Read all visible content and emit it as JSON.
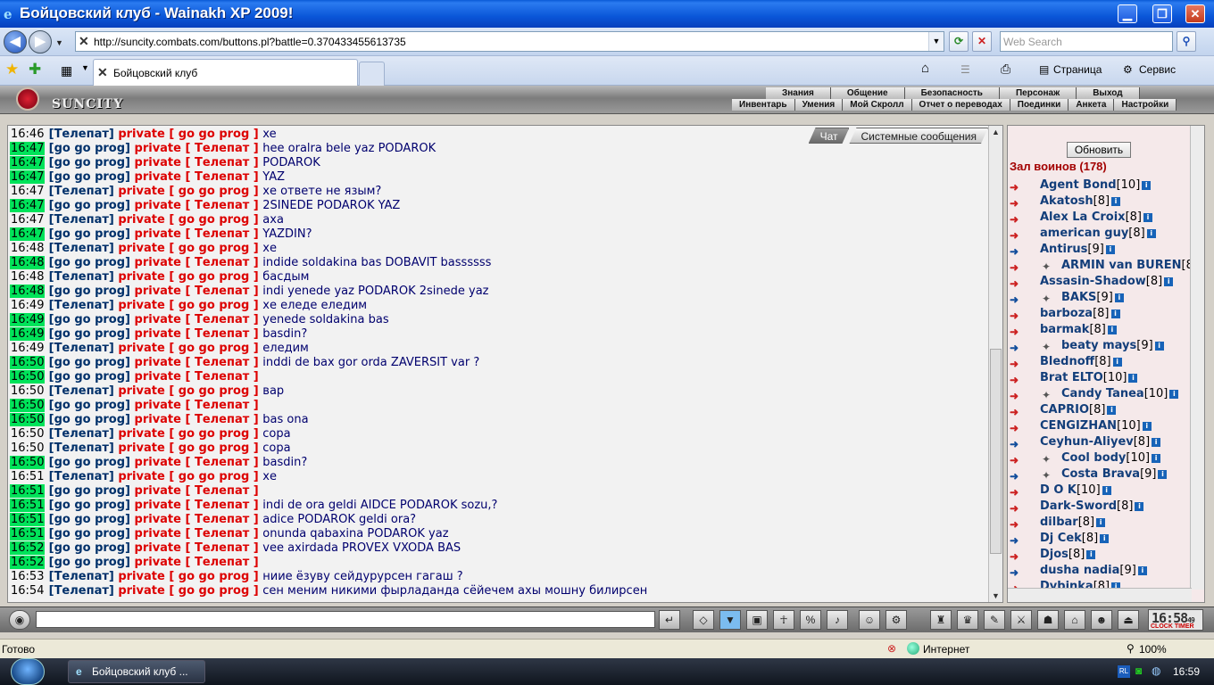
{
  "window": {
    "title": "Бойцовский клуб - Wainakh XP 2009!",
    "minimize": "▁",
    "maximize": "❐",
    "close": "✕"
  },
  "browser": {
    "url": "http://suncity.combats.com/buttons.pl?battle=0.370433455613735",
    "search_placeholder": "Web Search",
    "tab_title": "Бойцовский клуб",
    "page_menu": "Страница",
    "tools_menu": "Сервис",
    "status": "Готово",
    "zone": "Интернет",
    "zoom": "100%"
  },
  "game": {
    "logo": "SUNCITY",
    "menu_top": [
      "Знания",
      "Общение",
      "Безопасность",
      "Персонаж",
      "Выход"
    ],
    "menu_sub": [
      "Инвентарь",
      "Умения",
      "Мой Скролл",
      "Отчет о переводах",
      "Поединки",
      "Анкета",
      "Настройки"
    ],
    "chat_tabs": [
      "Чат",
      "Системные сообщения"
    ],
    "refresh_label": "Обновить",
    "hall_title": "Зал воинов (178)",
    "clock_time": "16:58",
    "clock_sec": "49",
    "clock_label": "CLOCK TIMER"
  },
  "chat": [
    {
      "time": "16:46",
      "hl": false,
      "from": "Телепат",
      "to": "go go prog",
      "msg": "xe"
    },
    {
      "time": "16:47",
      "hl": true,
      "from": "go go prog",
      "to": "Телепат",
      "msg": "hee oralra bele yaz PODAROK"
    },
    {
      "time": "16:47",
      "hl": true,
      "from": "go go prog",
      "to": "Телепат",
      "msg": "PODAROK"
    },
    {
      "time": "16:47",
      "hl": true,
      "from": "go go prog",
      "to": "Телепат",
      "msg": "YAZ"
    },
    {
      "time": "16:47",
      "hl": false,
      "from": "Телепат",
      "to": "go go prog",
      "msg": "хе ответе не язым?"
    },
    {
      "time": "16:47",
      "hl": true,
      "from": "go go prog",
      "to": "Телепат",
      "msg": "2SINEDE PODAROK YAZ"
    },
    {
      "time": "16:47",
      "hl": false,
      "from": "Телепат",
      "to": "go go prog",
      "msg": "аха"
    },
    {
      "time": "16:47",
      "hl": true,
      "from": "go go prog",
      "to": "Телепат",
      "msg": "YAZDIN?"
    },
    {
      "time": "16:48",
      "hl": false,
      "from": "Телепат",
      "to": "go go prog",
      "msg": "хе"
    },
    {
      "time": "16:48",
      "hl": true,
      "from": "go go prog",
      "to": "Телепат",
      "msg": "indide soldakina bas DOBAVIT bassssss"
    },
    {
      "time": "16:48",
      "hl": false,
      "from": "Телепат",
      "to": "go go prog",
      "msg": "басдым"
    },
    {
      "time": "16:48",
      "hl": true,
      "from": "go go prog",
      "to": "Телепат",
      "msg": "indi yenede yaz PODAROK 2sinede yaz"
    },
    {
      "time": "16:49",
      "hl": false,
      "from": "Телепат",
      "to": "go go prog",
      "msg": "хе еледе еледим"
    },
    {
      "time": "16:49",
      "hl": true,
      "from": "go go prog",
      "to": "Телепат",
      "msg": "yenede soldakina bas"
    },
    {
      "time": "16:49",
      "hl": true,
      "from": "go go prog",
      "to": "Телепат",
      "msg": "basdin?"
    },
    {
      "time": "16:49",
      "hl": false,
      "from": "Телепат",
      "to": "go go prog",
      "msg": "еледим"
    },
    {
      "time": "16:50",
      "hl": true,
      "from": "go go prog",
      "to": "Телепат",
      "msg": "inddi de bax gor orda ZAVERSIT var ?"
    },
    {
      "time": "16:50",
      "hl": true,
      "from": "go go prog",
      "to": "Телепат",
      "msg": ""
    },
    {
      "time": "16:50",
      "hl": false,
      "from": "Телепат",
      "to": "go go prog",
      "msg": "вар"
    },
    {
      "time": "16:50",
      "hl": true,
      "from": "go go prog",
      "to": "Телепат",
      "msg": ""
    },
    {
      "time": "16:50",
      "hl": true,
      "from": "go go prog",
      "to": "Телепат",
      "msg": "bas ona"
    },
    {
      "time": "16:50",
      "hl": false,
      "from": "Телепат",
      "to": "go go prog",
      "msg": "сора"
    },
    {
      "time": "16:50",
      "hl": false,
      "from": "Телепат",
      "to": "go go prog",
      "msg": "сора"
    },
    {
      "time": "16:50",
      "hl": true,
      "from": "go go prog",
      "to": "Телепат",
      "msg": "basdin?"
    },
    {
      "time": "16:51",
      "hl": false,
      "from": "Телепат",
      "to": "go go prog",
      "msg": "хе"
    },
    {
      "time": "16:51",
      "hl": true,
      "from": "go go prog",
      "to": "Телепат",
      "msg": ""
    },
    {
      "time": "16:51",
      "hl": true,
      "from": "go go prog",
      "to": "Телепат",
      "msg": "indi de ora geldi AIDCE PODAROK sozu,?"
    },
    {
      "time": "16:51",
      "hl": true,
      "from": "go go prog",
      "to": "Телепат",
      "msg": "adice PODAROK geldi ora?"
    },
    {
      "time": "16:51",
      "hl": true,
      "from": "go go prog",
      "to": "Телепат",
      "msg": "onunda qabaxina PODAROK yaz"
    },
    {
      "time": "16:52",
      "hl": true,
      "from": "go go prog",
      "to": "Телепат",
      "msg": "vee axirdada PROVEX VXODA BAS"
    },
    {
      "time": "16:52",
      "hl": true,
      "from": "go go prog",
      "to": "Телепат",
      "msg": ""
    },
    {
      "time": "16:53",
      "hl": false,
      "from": "Телепат",
      "to": "go go prog",
      "msg": "ниие ёзуву сейдурурсен гагаш ?"
    },
    {
      "time": "16:54",
      "hl": false,
      "from": "Телепат",
      "to": "go go prog",
      "msg": "сен меним никими фырладанда сёйечем ахы мошну билирсен"
    }
  ],
  "players": [
    {
      "name": "Agent Bond",
      "lvl": "[10]",
      "icon": "red",
      "clan": false
    },
    {
      "name": "Akatosh",
      "lvl": "[8]",
      "icon": "red",
      "clan": false
    },
    {
      "name": "Alex La Croix",
      "lvl": "[8]",
      "icon": "red",
      "clan": false
    },
    {
      "name": "american guy",
      "lvl": "[8]",
      "icon": "red",
      "clan": false
    },
    {
      "name": "Antirus",
      "lvl": "[9]",
      "icon": "blue",
      "clan": false
    },
    {
      "name": "ARMIN van BUREN",
      "lvl": "[8]",
      "icon": "red",
      "clan": true
    },
    {
      "name": "Assasin-Shadow",
      "lvl": "[8]",
      "icon": "red",
      "clan": false
    },
    {
      "name": "BAKS",
      "lvl": "[9]",
      "icon": "blue",
      "clan": true
    },
    {
      "name": "barboza",
      "lvl": "[8]",
      "icon": "red",
      "clan": false
    },
    {
      "name": "barmak",
      "lvl": "[8]",
      "icon": "red",
      "clan": false
    },
    {
      "name": "beaty mays",
      "lvl": "[9]",
      "icon": "blue",
      "clan": true
    },
    {
      "name": "Blednoff",
      "lvl": "[8]",
      "icon": "red",
      "clan": false
    },
    {
      "name": "Brat ELTO",
      "lvl": "[10]",
      "icon": "red",
      "clan": false
    },
    {
      "name": "Candy Tanea",
      "lvl": "[10]",
      "icon": "red",
      "clan": true
    },
    {
      "name": "CAPRIO",
      "lvl": "[8]",
      "icon": "red",
      "clan": false
    },
    {
      "name": "CENGIZHAN",
      "lvl": "[10]",
      "icon": "red",
      "clan": false
    },
    {
      "name": "Ceyhun-Aliyev",
      "lvl": "[8]",
      "icon": "blue",
      "clan": false
    },
    {
      "name": "Cool body",
      "lvl": "[10]",
      "icon": "red",
      "clan": true
    },
    {
      "name": "Costa Brava",
      "lvl": "[9]",
      "icon": "blue",
      "clan": true
    },
    {
      "name": "D O K",
      "lvl": "[10]",
      "icon": "red",
      "clan": false
    },
    {
      "name": "Dark-Sword",
      "lvl": "[8]",
      "icon": "red",
      "clan": false
    },
    {
      "name": "dilbar",
      "lvl": "[8]",
      "icon": "red",
      "clan": false
    },
    {
      "name": "Dj Cek",
      "lvl": "[8]",
      "icon": "blue",
      "clan": false
    },
    {
      "name": "Djos",
      "lvl": "[8]",
      "icon": "red",
      "clan": false
    },
    {
      "name": "dusha nadia",
      "lvl": "[9]",
      "icon": "blue",
      "clan": false
    },
    {
      "name": "Dybinka",
      "lvl": "[8]",
      "icon": "red",
      "clan": false
    }
  ],
  "taskbar": {
    "item": "Бойцовский клуб ...",
    "lang": "RL",
    "time": "16:59"
  }
}
